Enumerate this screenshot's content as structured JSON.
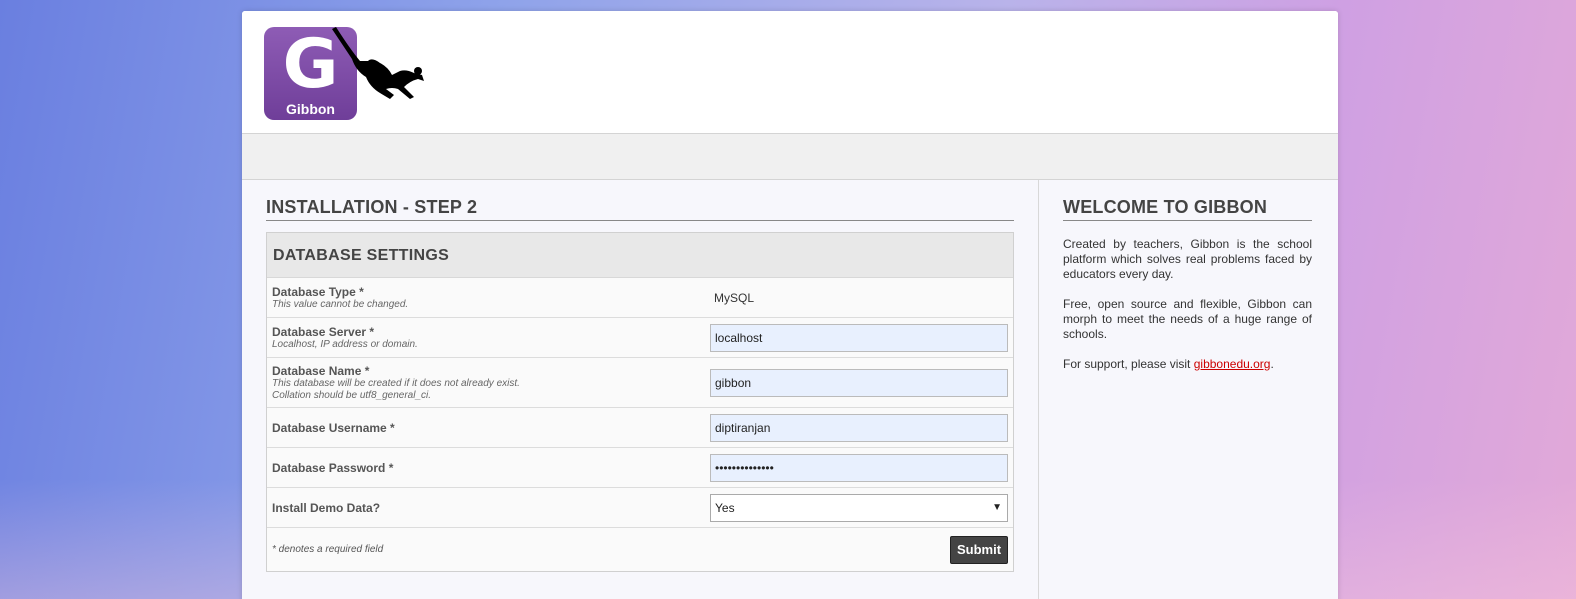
{
  "logo": {
    "text": "Gibbon"
  },
  "main": {
    "heading": "Installation - Step 2",
    "form_title": "Database Settings",
    "fields": [
      {
        "label": "Database Type *",
        "desc": "This value cannot be changed.",
        "value": "MySQL"
      },
      {
        "label": "Database Server *",
        "desc": "Localhost, IP address or domain.",
        "value": "localhost"
      },
      {
        "label": "Database Name *",
        "desc1": "This database will be created if it does not already exist.",
        "desc2": "Collation should be utf8_general_ci.",
        "value": "gibbon"
      },
      {
        "label": "Database Username *",
        "value": "diptiranjan"
      },
      {
        "label": "Database Password *",
        "value": "••••••••••••••"
      },
      {
        "label": "Install Demo Data?",
        "value": "Yes"
      }
    ],
    "required_note": "* denotes a required field",
    "submit_label": "Submit"
  },
  "sidebar": {
    "heading": "Welcome to Gibbon",
    "p1": "Created by teachers, Gibbon is the school platform which solves real problems faced by educators every day.",
    "p2": "Free, open source and flexible, Gibbon can morph to meet the needs of a huge range of schools.",
    "p3_prefix": "For support, please visit ",
    "p3_link": "gibbonedu.org",
    "p3_suffix": "."
  }
}
